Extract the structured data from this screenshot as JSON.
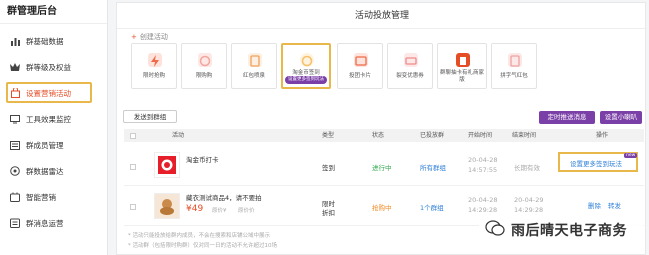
{
  "sidebar": {
    "title": "群管理后台",
    "items": [
      {
        "label": "群基础数据",
        "icon": "bar-chart-icon"
      },
      {
        "label": "群等级及权益",
        "icon": "crown-icon"
      },
      {
        "label": "设置营销活动",
        "icon": "shopping-bag-icon",
        "active": true
      },
      {
        "label": "工具效果监控",
        "icon": "monitor-icon"
      },
      {
        "label": "群成员管理",
        "icon": "members-icon"
      },
      {
        "label": "群数据雷达",
        "icon": "radar-icon"
      },
      {
        "label": "智能营销",
        "icon": "smart-icon"
      },
      {
        "label": "群消息运营",
        "icon": "message-icon"
      }
    ]
  },
  "main": {
    "title": "活动投放管理",
    "create_label": "创建活动",
    "tools": [
      {
        "label": "限时抢购",
        "color": "#f06a4a"
      },
      {
        "label": "限购购",
        "color": "#f2a6a0"
      },
      {
        "label": "红包喷泉",
        "color": "#f0a05a"
      },
      {
        "label": "淘金币签到",
        "color": "#f7c06b",
        "badge": "设置更多签到玩法"
      },
      {
        "label": "投团卡片",
        "color": "#f06a4a"
      },
      {
        "label": "裂变优惠券",
        "color": "#ef8a8a"
      },
      {
        "label": "群聊抽卡有礼商家版",
        "color": "#e54d26"
      },
      {
        "label": "拼字气红包",
        "color": "#f0a0a0"
      }
    ],
    "send_button": "发送到群组",
    "timed_button": "定时推送消息",
    "settings_button": "设置小喇叭"
  },
  "table": {
    "headers": [
      "活动",
      "类型",
      "状态",
      "已投放群",
      "开始时间",
      "结束时间",
      "操作"
    ],
    "rows": [
      {
        "name": "淘金币打卡",
        "type": "签到",
        "status": "进行中",
        "groups": "所有群组",
        "start_date": "20-04-28",
        "start_time": "14:57:55",
        "end": "长期有效",
        "action": "设置更多签到玩法",
        "badge": "new"
      },
      {
        "name": "藏衣测试商品4，请不要拍",
        "price": "¥49",
        "orig_price": "原价¥",
        "price_label": "原价价",
        "type_line1": "限时",
        "type_line2": "折扣",
        "status": "抢购中",
        "groups": "1个群组",
        "start_date": "20-04-28",
        "start_time": "14:29:28",
        "end_date": "20-04-29",
        "end_time": "14:29:28",
        "action1": "删除",
        "action2": "转发"
      }
    ]
  },
  "notes": [
    "* 活动只能投放给群内成员，不会在搜索和店铺公域中展示",
    "* 活动群（包括限时购群）仅对同一日的活动不允许超过10场"
  ],
  "watermark": "雨后晴天电子商务"
}
